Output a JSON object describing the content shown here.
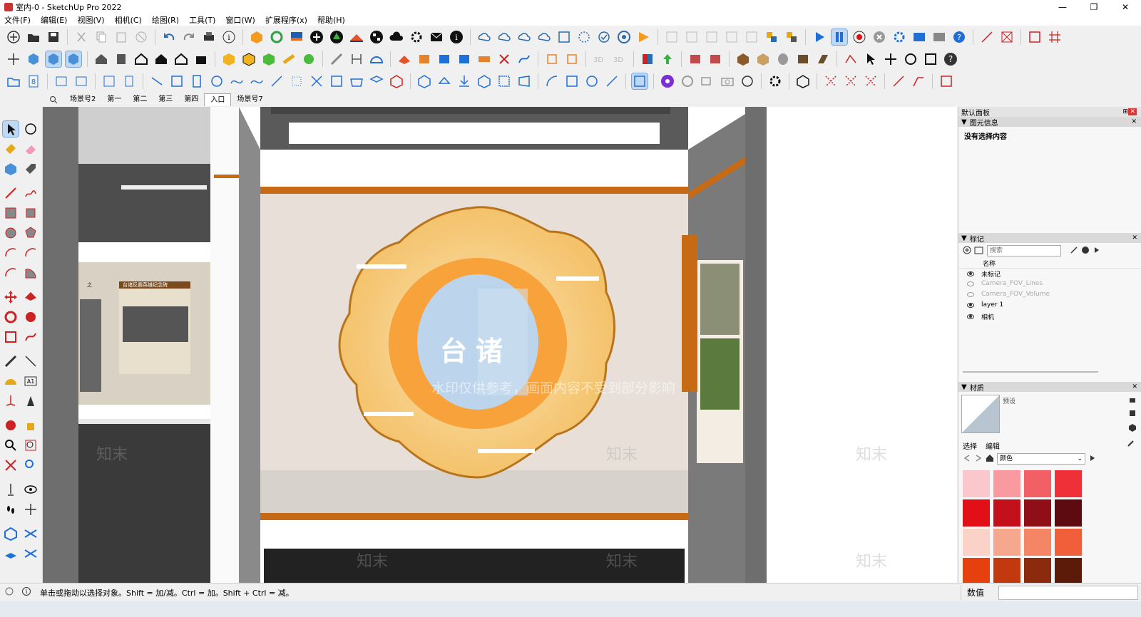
{
  "window": {
    "title": "室内-0 - SketchUp Pro 2022",
    "minimize": "—",
    "maximize": "❐",
    "close": "✕"
  },
  "menu": [
    "文件(F)",
    "编辑(E)",
    "视图(V)",
    "相机(C)",
    "绘图(R)",
    "工具(T)",
    "窗口(W)",
    "扩展程序(x)",
    "帮助(H)"
  ],
  "scenes": {
    "tabs": [
      "场景号2",
      "第一",
      "第二",
      "第三",
      "第四",
      "入口",
      "场景号7"
    ],
    "active_index": 5
  },
  "viewport": {
    "wall_center_chars": [
      "台",
      "诸"
    ],
    "left_board_title": "台诸反霸英雄纪念碑",
    "left_board_prefix": "之",
    "watermark_logo": "知末",
    "watermark_text": "水印仅供参考，画面内容不受到部分影响"
  },
  "right_panel": {
    "header": "默认面板",
    "entity_info": {
      "title": "图元信息",
      "status": "没有选择内容"
    },
    "tags": {
      "title": "标记",
      "search_placeholder": "搜索",
      "col_name": "名称",
      "rows": [
        {
          "name": "未标记",
          "visible": true
        },
        {
          "name": "Camera_FOV_Lines",
          "visible": false
        },
        {
          "name": "Camera_FOV_Volume",
          "visible": false
        },
        {
          "name": "layer 1",
          "visible": true
        },
        {
          "name": "相机",
          "visible": true
        }
      ]
    },
    "materials": {
      "title": "材质",
      "preset_label": "预设",
      "tab_select": "选择",
      "tab_edit": "编辑",
      "dropdown_value": "颜色",
      "swatches": [
        "#f9c7cc",
        "#f99aa0",
        "#f26065",
        "#ef3038",
        "#e20f16",
        "#c4101a",
        "#8f0e18",
        "#5d0a10",
        "#fbd2c7",
        "#f5a88e",
        "#f58665",
        "#f15f3a",
        "#e6400e",
        "#c2380f",
        "#8b2a0d",
        "#5c1b08"
      ]
    }
  },
  "status": {
    "hint": "单击或拖动以选择对象。Shift = 加/减。Ctrl = 加。Shift + Ctrl = 减。",
    "measurements_label": "数值"
  },
  "colors": {
    "accent_orange": "#c66a15",
    "panel_bg": "#f7f7f7",
    "selection_blue": "#bfd9f5"
  }
}
